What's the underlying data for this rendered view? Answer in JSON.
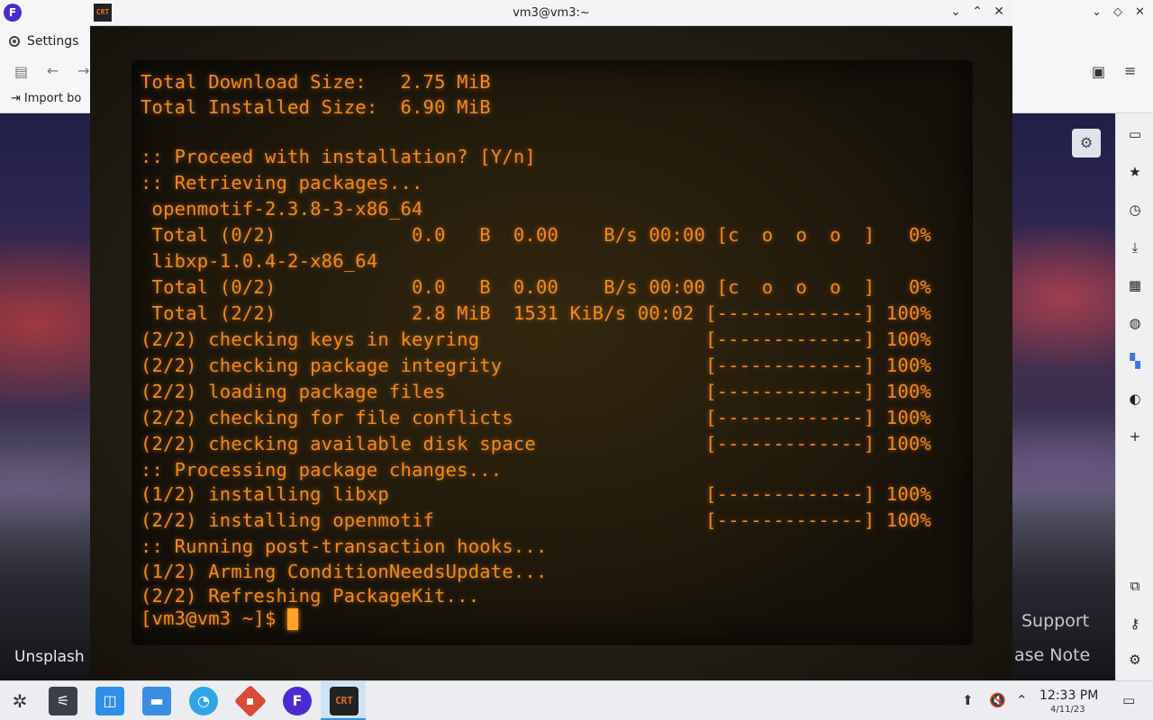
{
  "browser": {
    "settings_tab_label": "Settings",
    "bookmark_label": "Import bo",
    "back_icon": "arrow-left-icon",
    "forward_icon": "arrow-right-icon"
  },
  "wallpaper": {
    "credit": "Unsplash",
    "support_text": "Support",
    "release_note_text": "ase Note"
  },
  "terminal": {
    "app_icon_text": "CRT",
    "window_title": "vm3@vm3:~",
    "lines": [
      "Total Download Size:   2.75 MiB",
      "Total Installed Size:  6.90 MiB",
      ":: Proceed with installation? [Y/n]",
      ":: Retrieving packages...",
      " openmotif-2.3.8-3-x86_64",
      " Total (0/2)            0.0   B  0.00    B/s 00:00 [c  o  o  o  ]   0%",
      " libxp-1.0.4-2-x86_64",
      " Total (0/2)            0.0   B  0.00    B/s 00:00 [c  o  o  o  ]   0%",
      " Total (2/2)            2.8 MiB  1531 KiB/s 00:02 [-------------] 100%",
      "(2/2) checking keys in keyring                    [-------------] 100%",
      "(2/2) checking package integrity                  [-------------] 100%",
      "(2/2) loading package files                       [-------------] 100%",
      "(2/2) checking for file conflicts                 [-------------] 100%",
      "(2/2) checking available disk space               [-------------] 100%",
      ":: Processing package changes...",
      "(1/2) installing libxp                            [-------------] 100%",
      "(2/2) installing openmotif                        [-------------] 100%",
      ":: Running post-transaction hooks...",
      "(1/2) Arming ConditionNeedsUpdate...",
      "(2/2) Refreshing PackageKit..."
    ],
    "prompt": "[vm3@vm3 ~]$ "
  },
  "taskbar": {
    "clock_time": "12:33 PM",
    "clock_date": "4/11/23",
    "crt_icon_text": "CRT"
  },
  "colors": {
    "phosphor": "#f08a1e",
    "accent": "#3a8ee0"
  }
}
